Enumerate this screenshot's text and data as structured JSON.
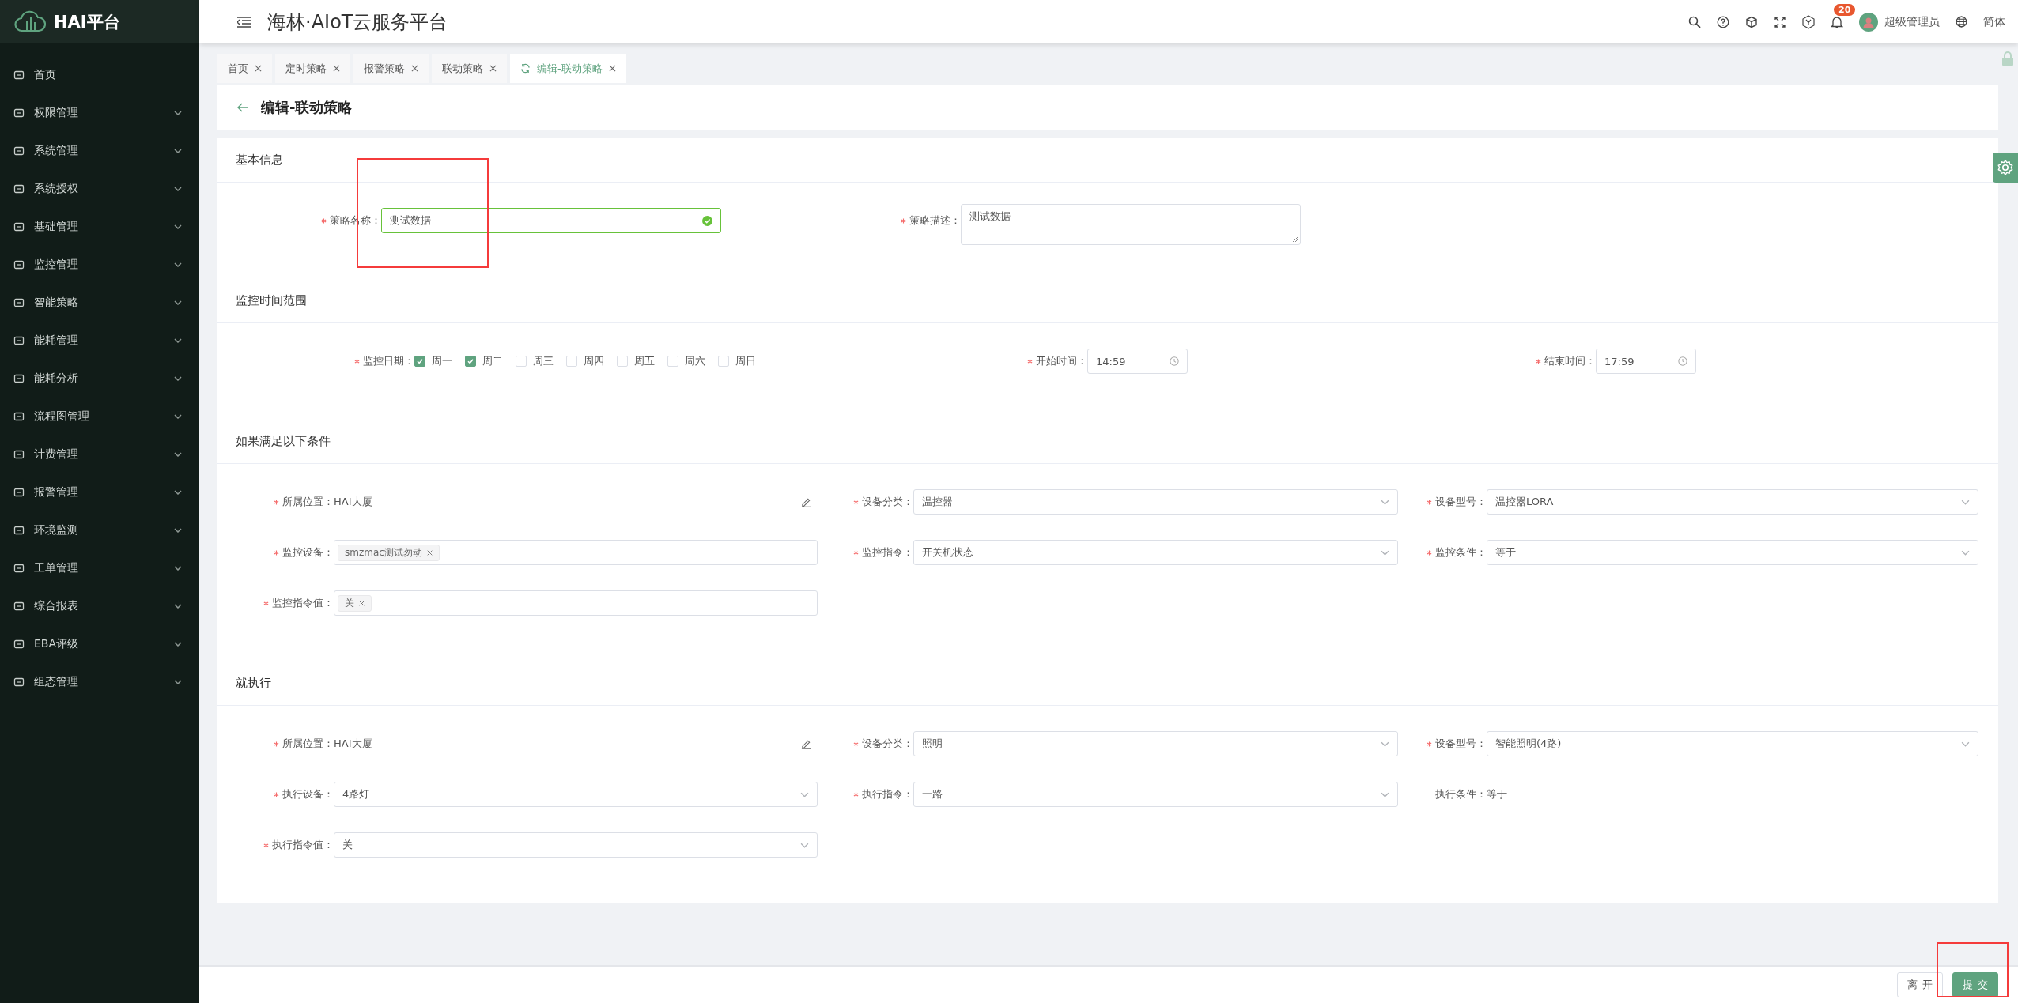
{
  "sidebar": {
    "logo": "HAI平台",
    "items": [
      {
        "label": "首页",
        "expandable": false
      },
      {
        "label": "权限管理",
        "expandable": true
      },
      {
        "label": "系统管理",
        "expandable": true
      },
      {
        "label": "系统授权",
        "expandable": true
      },
      {
        "label": "基础管理",
        "expandable": true
      },
      {
        "label": "监控管理",
        "expandable": true
      },
      {
        "label": "智能策略",
        "expandable": true
      },
      {
        "label": "能耗管理",
        "expandable": true
      },
      {
        "label": "能耗分析",
        "expandable": true
      },
      {
        "label": "流程图管理",
        "expandable": true
      },
      {
        "label": "计费管理",
        "expandable": true
      },
      {
        "label": "报警管理",
        "expandable": true
      },
      {
        "label": "环境监测",
        "expandable": true
      },
      {
        "label": "工单管理",
        "expandable": true
      },
      {
        "label": "综合报表",
        "expandable": true
      },
      {
        "label": "EBA评级",
        "expandable": true
      },
      {
        "label": "组态管理",
        "expandable": true
      }
    ]
  },
  "header": {
    "title": "海林·AIoT云服务平台",
    "notification_count": "20",
    "user": "超级管理员",
    "language": "简体"
  },
  "tabs": [
    {
      "label": "首页",
      "selected": false
    },
    {
      "label": "定时策略",
      "selected": false
    },
    {
      "label": "报警策略",
      "selected": false
    },
    {
      "label": "联动策略",
      "selected": false
    },
    {
      "label": "编辑-联动策略",
      "selected": true
    }
  ],
  "page_title": "编辑-联动策略",
  "sections": [
    {
      "title": "基本信息",
      "fields": [
        {
          "kind": "input",
          "label": "策略名称：",
          "required": true,
          "value": "测试数据",
          "valid": true,
          "highlighted": true
        },
        {
          "kind": "textarea",
          "label": "策略描述：",
          "required": true,
          "value": "测试数据"
        }
      ]
    },
    {
      "title": "监控时间范围",
      "fields": [
        {
          "kind": "checkboxes",
          "label": "监控日期：",
          "required": true,
          "options": [
            {
              "label": "周一",
              "checked": true
            },
            {
              "label": "周二",
              "checked": true
            },
            {
              "label": "周三",
              "checked": false
            },
            {
              "label": "周四",
              "checked": false
            },
            {
              "label": "周五",
              "checked": false
            },
            {
              "label": "周六",
              "checked": false
            },
            {
              "label": "周日",
              "checked": false
            }
          ]
        },
        {
          "kind": "time",
          "label": "开始时间：",
          "required": true,
          "value": "14:59"
        },
        {
          "kind": "time",
          "label": "结束时间：",
          "required": true,
          "value": "17:59"
        }
      ]
    },
    {
      "title": "如果满足以下条件",
      "fields": [
        {
          "kind": "location",
          "label": "所属位置：",
          "required": true,
          "value": "HAI大厦"
        },
        {
          "kind": "select",
          "label": "设备分类：",
          "required": true,
          "value": "温控器"
        },
        {
          "kind": "select",
          "label": "设备型号：",
          "required": true,
          "value": "温控器LORA"
        },
        {
          "kind": "tags",
          "label": "监控设备：",
          "required": true,
          "tags": [
            "smzmac测试勿动"
          ]
        },
        {
          "kind": "select",
          "label": "监控指令：",
          "required": true,
          "value": "开关机状态"
        },
        {
          "kind": "select",
          "label": "监控条件：",
          "required": true,
          "value": "等于"
        },
        {
          "kind": "tags",
          "label": "监控指令值：",
          "required": true,
          "tags": [
            "关"
          ]
        }
      ]
    },
    {
      "title": "就执行",
      "fields": [
        {
          "kind": "location",
          "label": "所属位置：",
          "required": true,
          "value": "HAI大厦"
        },
        {
          "kind": "select",
          "label": "设备分类：",
          "required": true,
          "value": "照明"
        },
        {
          "kind": "select",
          "label": "设备型号：",
          "required": true,
          "value": "智能照明(4路)"
        },
        {
          "kind": "select",
          "label": "执行设备：",
          "required": true,
          "value": "4路灯"
        },
        {
          "kind": "select",
          "label": "执行指令：",
          "required": true,
          "value": "一路"
        },
        {
          "kind": "text",
          "label": "执行条件：",
          "required": false,
          "value": "等于"
        },
        {
          "kind": "select",
          "label": "执行指令值：",
          "required": true,
          "value": "关"
        }
      ]
    }
  ],
  "footer": {
    "buttons": [
      {
        "label": "离开",
        "kind": "default",
        "highlighted": false
      },
      {
        "label": "提交",
        "kind": "primary",
        "highlighted": true
      }
    ]
  }
}
